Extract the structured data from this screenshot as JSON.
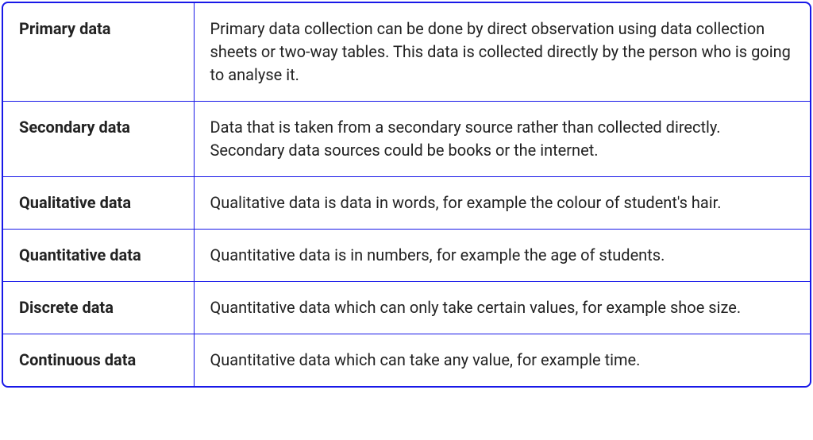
{
  "rows": [
    {
      "term": "Primary data",
      "definition": "Primary data collection can be done by direct observation using data collection sheets or two-way tables. This data is collected directly by the person who is going to analyse it."
    },
    {
      "term": "Secondary data",
      "definition": "Data that is taken from a secondary source rather than collected directly. Secondary data sources could be books or the internet."
    },
    {
      "term": "Qualitative data",
      "definition": "Qualitative data is data in words, for example the colour of student's hair."
    },
    {
      "term": "Quantitative data",
      "definition": "Quantitative data is in numbers, for example the age of students."
    },
    {
      "term": "Discrete data",
      "definition": "Quantitative data which can only take certain values, for example shoe size."
    },
    {
      "term": "Continuous data",
      "definition": "Quantitative data which can take any value, for example time."
    }
  ]
}
